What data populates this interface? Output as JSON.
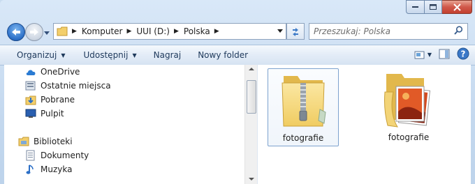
{
  "address": {
    "crumbs": [
      "Komputer",
      "UUI (D:)",
      "Polska"
    ]
  },
  "search": {
    "placeholder": "Przeszukaj: Polska"
  },
  "toolbar": {
    "organize": "Organizuj",
    "share": "Udostępnij",
    "burn": "Nagraj",
    "new_folder": "Nowy folder"
  },
  "nav": {
    "favorites": [
      {
        "label": "OneDrive",
        "icon": "onedrive-icon"
      },
      {
        "label": "Ostatnie miejsca",
        "icon": "recent-places-icon"
      },
      {
        "label": "Pobrane",
        "icon": "downloads-icon"
      },
      {
        "label": "Pulpit",
        "icon": "desktop-icon"
      }
    ],
    "libraries_label": "Biblioteki",
    "libraries": [
      {
        "label": "Dokumenty",
        "icon": "documents-icon"
      },
      {
        "label": "Muzyka",
        "icon": "music-icon"
      }
    ]
  },
  "items": [
    {
      "label": "fotografie",
      "icon": "zip-folder-icon",
      "selected": true
    },
    {
      "label": "fotografie",
      "icon": "photo-folder-icon",
      "selected": false
    }
  ],
  "colors": {
    "accent": "#2b6fc7",
    "close": "#c3402f"
  }
}
